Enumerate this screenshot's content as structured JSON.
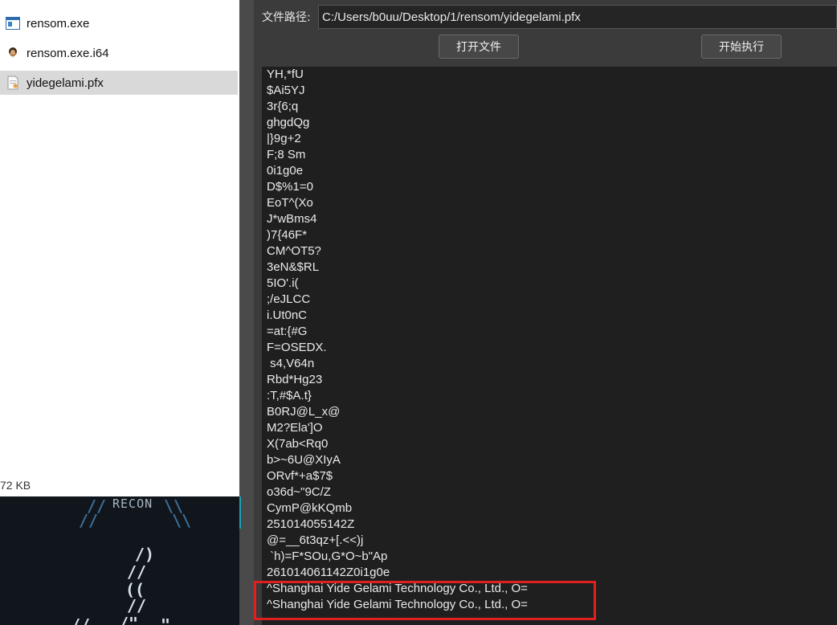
{
  "explorer": {
    "files": [
      {
        "name": "rensom.exe",
        "icon": "exe-window-icon",
        "selected": false
      },
      {
        "name": "rensom.exe.i64",
        "icon": "ida-database-icon",
        "selected": false
      },
      {
        "name": "yidegelami.pfx",
        "icon": "certificate-file-icon",
        "selected": true
      }
    ],
    "size_text": "72 KB"
  },
  "wallpaper": {
    "recon_text": "RECON",
    "glyphs": [
      "//",
      "\\\\",
      "//",
      "\\\\",
      "/)",
      "//",
      "((",
      "//",
      "/\"",
      "//",
      "\""
    ]
  },
  "app": {
    "path_label": "文件路径:",
    "path_value": "C:/Users/b0uu/Desktop/1/rensom/yidegelami.pfx",
    "open_button": "打开文件",
    "run_button": "开始执行",
    "output_lines": [
      "YH,*fU",
      "$Ai5YJ",
      "3r{6;q",
      "ghgdQg",
      "|}9g+2",
      "F;8 Sm",
      "0i1g0e",
      "D$%1=0",
      "EoT^(Xo",
      "J*wBms4",
      ")7{46F*",
      "CM^OT5?",
      "3eN&$RL",
      "5IO'.i(",
      ";/eJLCC",
      "i.Ut0nC",
      "=at:{#G",
      "F=OSEDX.",
      " s4,V64n",
      "Rbd*Hg23",
      ":T,#$A.t}",
      "B0RJ@L_x@",
      "M2?Ela']O",
      "X(7ab<Rq0",
      "b>~6U@XIyA",
      "ORvf*+a$7$",
      "o36d~\"9C/Z",
      "CymP@kKQmb",
      "251014055142Z",
      "@=__6t3qz+[.<<)j",
      " `h)=F*SOu,G*O~b\"Ap",
      "261014061142Z0i1g0e",
      "^Shanghai Yide Gelami Technology Co., Ltd., O=",
      "^Shanghai Yide Gelami Technology Co., Ltd., O="
    ]
  },
  "colors": {
    "highlight_box": "#e0201e",
    "output_bg": "#1f1f1f",
    "app_bg": "#3b3b3b",
    "selected_row": "#d9d9d9"
  }
}
